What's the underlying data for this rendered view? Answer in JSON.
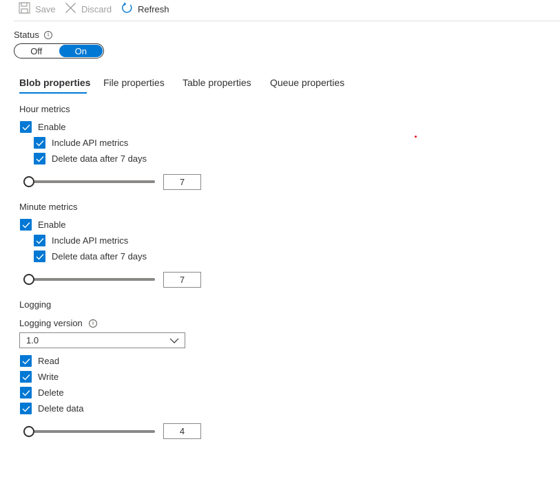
{
  "toolbar": {
    "save_label": "Save",
    "discard_label": "Discard",
    "refresh_label": "Refresh"
  },
  "status": {
    "label": "Status",
    "off_label": "Off",
    "on_label": "On",
    "selected": "On"
  },
  "tabs": [
    {
      "label": "Blob properties",
      "active": true
    },
    {
      "label": "File properties",
      "active": false
    },
    {
      "label": "Table properties",
      "active": false
    },
    {
      "label": "Queue properties",
      "active": false
    }
  ],
  "hour_metrics": {
    "title": "Hour metrics",
    "enable_label": "Enable",
    "include_api_label": "Include API metrics",
    "delete_data_label": "Delete data after 7 days",
    "retention_days": "7"
  },
  "minute_metrics": {
    "title": "Minute metrics",
    "enable_label": "Enable",
    "include_api_label": "Include API metrics",
    "delete_data_label": "Delete data after 7 days",
    "retention_days": "7"
  },
  "logging": {
    "title": "Logging",
    "version_label": "Logging version",
    "version_value": "1.0",
    "read_label": "Read",
    "write_label": "Write",
    "delete_label": "Delete",
    "delete_data_label": "Delete data",
    "retention_days": "4"
  },
  "colors": {
    "accent": "#0078d4",
    "disabled_text": "#a19f9d"
  },
  "icons": {
    "save": "save-icon",
    "discard": "close-icon",
    "refresh": "refresh-icon",
    "info": "info-icon",
    "check": "checkmark-icon",
    "chevron": "chevron-down-icon"
  }
}
